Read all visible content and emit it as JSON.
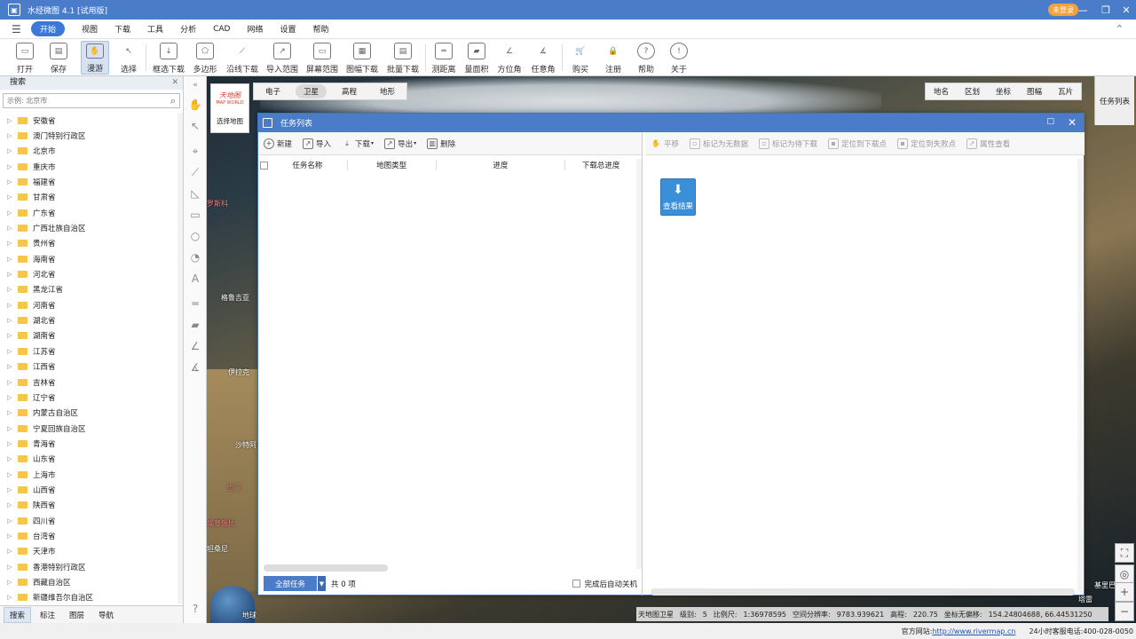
{
  "titlebar": {
    "title": "水经微图 4.1 [试用版]",
    "login": "未登录",
    "min": "—",
    "restore": "❐",
    "close": "✕"
  },
  "menu": {
    "items": [
      {
        "label": "开始",
        "active": true
      },
      {
        "label": "视图"
      },
      {
        "label": "下载"
      },
      {
        "label": "工具"
      },
      {
        "label": "分析"
      },
      {
        "label": "CAD"
      },
      {
        "label": "网络"
      },
      {
        "label": "设置"
      },
      {
        "label": "帮助"
      }
    ]
  },
  "toolbar": {
    "tools": [
      {
        "label": "打开",
        "icon": "folder-icon"
      },
      {
        "label": "保存",
        "icon": "save-icon"
      },
      {
        "label": "漫游",
        "icon": "hand-icon",
        "active": true
      },
      {
        "label": "选择",
        "icon": "cursor-icon"
      },
      {
        "label": "框选下载",
        "icon": "rect-download-icon"
      },
      {
        "label": "多边形",
        "icon": "polygon-icon"
      },
      {
        "label": "沿线下载",
        "icon": "line-download-icon"
      },
      {
        "label": "导入范围",
        "icon": "import-range-icon"
      },
      {
        "label": "屏幕范围",
        "icon": "screen-range-icon"
      },
      {
        "label": "图幅下载",
        "icon": "sheet-download-icon"
      },
      {
        "label": "批量下载",
        "icon": "batch-download-icon"
      },
      {
        "label": "测距离",
        "icon": "ruler-icon"
      },
      {
        "label": "量面积",
        "icon": "area-icon"
      },
      {
        "label": "方位角",
        "icon": "azimuth-icon"
      },
      {
        "label": "任意角",
        "icon": "angle-icon"
      },
      {
        "label": "购买",
        "icon": "cart-icon"
      },
      {
        "label": "注册",
        "icon": "lock-icon"
      },
      {
        "label": "帮助",
        "icon": "help-icon"
      },
      {
        "label": "关于",
        "icon": "info-icon"
      }
    ]
  },
  "search": {
    "header": "搜索",
    "placeholder": "示例: 北京市"
  },
  "provinces": [
    "安徽省",
    "澳门特别行政区",
    "北京市",
    "重庆市",
    "福建省",
    "甘肃省",
    "广东省",
    "广西壮族自治区",
    "贵州省",
    "海南省",
    "河北省",
    "黑龙江省",
    "河南省",
    "湖北省",
    "湖南省",
    "江苏省",
    "江西省",
    "吉林省",
    "辽宁省",
    "内蒙古自治区",
    "宁夏回族自治区",
    "青海省",
    "山东省",
    "上海市",
    "山西省",
    "陕西省",
    "四川省",
    "台湾省",
    "天津市",
    "香港特别行政区",
    "西藏自治区",
    "新疆维吾尔自治区"
  ],
  "leftTabs": [
    "搜索",
    "标注",
    "图层",
    "导航"
  ],
  "map": {
    "logoBrand": "天地图",
    "logoSub": "MAP WORLD",
    "selectMap": "选择地图",
    "types": [
      "电子",
      "卫星",
      "高程",
      "地形"
    ],
    "activeType": "卫星",
    "tools": [
      "地名",
      "区划",
      "坐标",
      "图幅",
      "瓦片"
    ],
    "taskListTab": "任务列表",
    "labels": {
      "a": "格鲁吉亚",
      "b": "伊拉克",
      "c": "沙特阿",
      "d": "也门",
      "e": "埃塞俄比",
      "f": "坦桑尼",
      "g": "罗斯科",
      "h": "地球",
      "i": "塔雷",
      "j": "基里巴"
    }
  },
  "dialog": {
    "title": "任务列表",
    "leftToolbar": [
      "新建",
      "导入",
      "下载",
      "导出",
      "删除"
    ],
    "rightToolbar": [
      "平移",
      "标记为无数据",
      "标记为待下载",
      "定位到下载点",
      "定位到失败点",
      "属性查看"
    ],
    "columns": [
      "任务名称",
      "地图类型",
      "进度",
      "下载总进度"
    ],
    "allTasks": "全部任务",
    "count": "共 0 项",
    "autoShutdown": "完成后自动关机",
    "viewResult": "查看结果"
  },
  "status": {
    "source": "天地图卫星",
    "levelLabel": "级别:",
    "level": "5",
    "scaleLabel": "比例尺:",
    "scale": "1:36978595",
    "resLabel": "空间分辨率:",
    "res": "9783.939621",
    "elevLabel": "高程:",
    "elev": "220.75",
    "offsetLabel": "坐标无偏移:",
    "coords": "154.24804688, 66.44531250"
  },
  "footer": {
    "siteLabel": "官方网站:",
    "site": "http://www.rivermap.cn",
    "hotlineLabel": "24小时客服电话:",
    "hotline": "400-028-0050"
  }
}
